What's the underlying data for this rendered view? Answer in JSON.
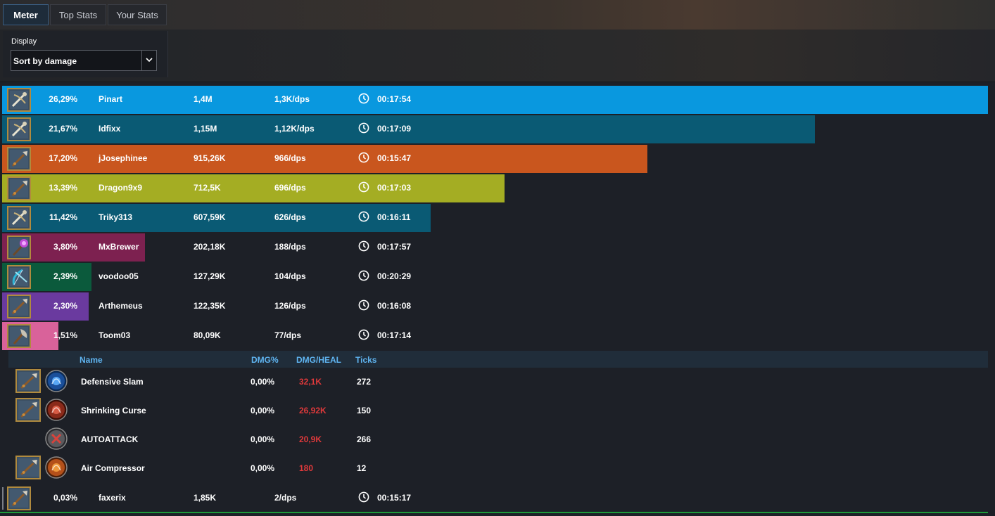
{
  "tabs": [
    {
      "label": "Meter",
      "active": true
    },
    {
      "label": "Top Stats",
      "active": false
    },
    {
      "label": "Your Stats",
      "active": false
    }
  ],
  "display": {
    "label": "Display",
    "selected": "Sort by damage",
    "icon": "chevron-down-icon"
  },
  "players": [
    {
      "pct": "26,29%",
      "name": "Pinart",
      "damage": "1,4M",
      "dps": "1,3K/dps",
      "time": "00:17:54",
      "share": 26.29,
      "color": "#0998df",
      "icon": "crossbow-icon"
    },
    {
      "pct": "21,67%",
      "name": "Idfixx",
      "damage": "1,15M",
      "dps": "1,12K/dps",
      "time": "00:17:09",
      "share": 21.67,
      "color": "#0a5a74",
      "icon": "crossbow-icon"
    },
    {
      "pct": "17,20%",
      "name": "jJosephinee",
      "damage": "915,26K",
      "dps": "966/dps",
      "time": "00:15:47",
      "share": 17.2,
      "color": "#c9561e",
      "icon": "spear-icon"
    },
    {
      "pct": "13,39%",
      "name": "Dragon9x9",
      "damage": "712,5K",
      "dps": "696/dps",
      "time": "00:17:03",
      "share": 13.39,
      "color": "#a4ad23",
      "icon": "spear-icon"
    },
    {
      "pct": "11,42%",
      "name": "Triky313",
      "damage": "607,59K",
      "dps": "626/dps",
      "time": "00:16:11",
      "share": 11.42,
      "color": "#0a5a74",
      "icon": "crossbow-icon"
    },
    {
      "pct": "3,80%",
      "name": "MxBrewer",
      "damage": "202,18K",
      "dps": "188/dps",
      "time": "00:17:57",
      "share": 3.8,
      "color": "#7d2150",
      "icon": "staff-icon"
    },
    {
      "pct": "2,39%",
      "name": "voodoo05",
      "damage": "127,29K",
      "dps": "104/dps",
      "time": "00:20:29",
      "share": 2.39,
      "color": "#0b5a3c",
      "icon": "bow-icon"
    },
    {
      "pct": "2,30%",
      "name": "Arthemeus",
      "damage": "122,35K",
      "dps": "126/dps",
      "time": "00:16:08",
      "share": 2.3,
      "color": "#6a3a9f",
      "icon": "spear-icon"
    },
    {
      "pct": "1,51%",
      "name": "Toom03",
      "damage": "80,09K",
      "dps": "77/dps",
      "time": "00:17:14",
      "share": 1.51,
      "color": "#d9629a",
      "icon": "axe-icon"
    }
  ],
  "detail": {
    "headers": {
      "name": "Name",
      "pct": "DMG%",
      "heal": "DMG/HEAL",
      "ticks": "Ticks"
    },
    "skills": [
      {
        "name": "Defensive Slam",
        "pct": "0,00%",
        "heal": "32,1K",
        "ticks": "272",
        "orb": "blue-slam-icon",
        "weapon": true
      },
      {
        "name": "Shrinking Curse",
        "pct": "0,00%",
        "heal": "26,92K",
        "ticks": "150",
        "orb": "red-curse-icon",
        "weapon": true
      },
      {
        "name": "AUTOATTACK",
        "pct": "0,00%",
        "heal": "20,9K",
        "ticks": "266",
        "orb": "crossed-swords-icon",
        "weapon": false
      },
      {
        "name": "Air Compressor",
        "pct": "0,00%",
        "heal": "180",
        "ticks": "12",
        "orb": "orange-burst-icon",
        "weapon": true
      }
    ]
  },
  "last_player": {
    "pct": "0,03%",
    "name": "faxerix",
    "damage": "1,85K",
    "dps": "2/dps",
    "time": "00:15:17",
    "icon": "spear-icon"
  }
}
